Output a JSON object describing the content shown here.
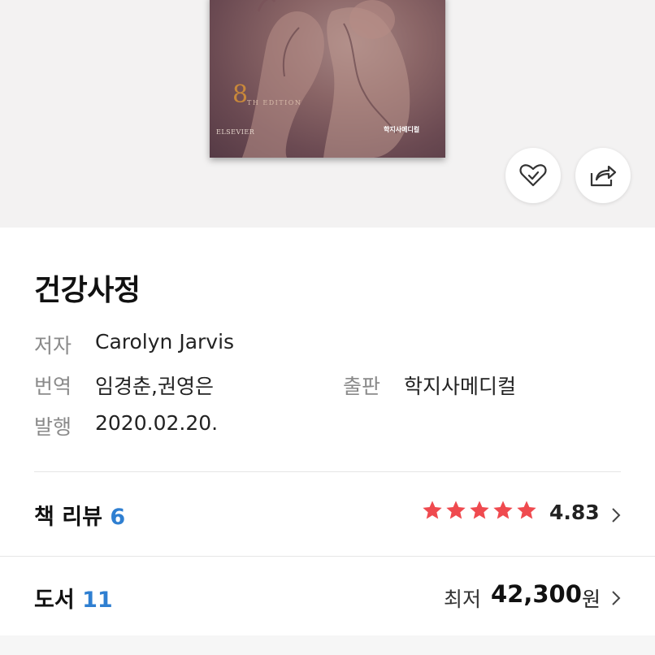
{
  "cover": {
    "edition_number": "8",
    "edition_text": "TH EDITION",
    "publisher": "ELSEVIER",
    "local_publisher": "학지사메디컬"
  },
  "actions": {
    "like_icon": "heart-check-icon",
    "share_icon": "share-icon"
  },
  "book": {
    "title": "건강사정",
    "author_label": "저자",
    "author": "Carolyn Jarvis",
    "translator_label": "번역",
    "translator": "임경춘,권영은",
    "publisher_label": "출판",
    "publisher": "학지사메디컬",
    "published_label": "발행",
    "published_date": "2020.02.20."
  },
  "reviews": {
    "label": "책 리뷰",
    "count": "6",
    "stars_filled": 5,
    "star_color": "#ef4a4f",
    "rating": "4.83"
  },
  "listings": {
    "label": "도서",
    "count": "11",
    "price_prefix": "최저",
    "price": "42,300",
    "price_unit": "원"
  },
  "colors": {
    "accent_blue": "#2f7fd1",
    "hero_bg": "#f3f2f2"
  }
}
